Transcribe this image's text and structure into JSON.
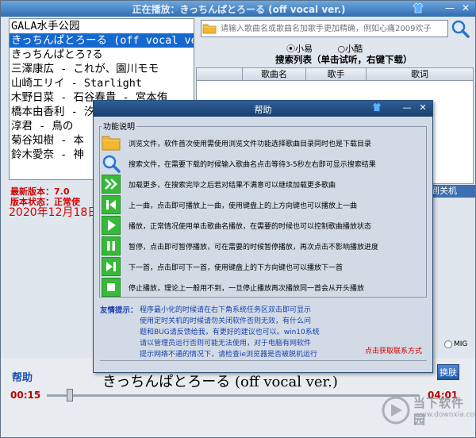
{
  "window": {
    "title": "正在播放：きっちんぱとろーる (off vocal ver.)"
  },
  "song_list": [
    {
      "text": "GALA水手公园",
      "selected": false
    },
    {
      "text": "きっちんぱとろーる (off vocal ver.)",
      "selected": true
    },
    {
      "text": "きっちんぱとろ?る",
      "selected": false
    },
    {
      "text": "三澤康広 - これが、園川モモ",
      "selected": false
    },
    {
      "text": "山崎エリイ - Starlight",
      "selected": false
    },
    {
      "text": "木野日菜 - 石谷春貴 - 宮本侑",
      "selected": false
    },
    {
      "text": "橋本由香利 - 汐",
      "selected": false
    },
    {
      "text": "淳君 - 鳥の",
      "selected": false
    },
    {
      "text": "菊谷知樹 - 本",
      "selected": false
    },
    {
      "text": "鈴木愛奈 - 神",
      "selected": false
    }
  ],
  "search": {
    "placeholder": "请输入歌曲名或歌曲名加歌手更加精确，例如心痛2009欢子",
    "source_options": [
      "小易",
      "小酷"
    ],
    "source_selected": "小易",
    "results_title": "搜索列表（单击试听，右键下载）",
    "columns": [
      "歌曲名",
      "歌手",
      "歌词"
    ]
  },
  "status": {
    "version": "最新版本：7.0",
    "state": "版本状态：正常使",
    "date": "2020年12月18日",
    "shutdown": "到关机"
  },
  "mig_label": "MIG",
  "bottom": {
    "help_link": "帮助",
    "now_playing": "きっちんぱとろーる (off vocal ver.)",
    "switch_button": "换肤",
    "elapsed": "00:15",
    "total": "04:01",
    "progress_fraction": 0.062
  },
  "watermark": {
    "text": "当下软件园",
    "sub": "www.downxia.com"
  },
  "help": {
    "title": "帮助",
    "legend": "功能说明",
    "items": [
      {
        "icon": "folder-icon",
        "text": "浏览文件，软件首次使用需使用浏览文件功能选择歌曲目录同时也是下载目录"
      },
      {
        "icon": "search-icon",
        "text": "搜索文件，在需要下载的时候输入歌曲名点击等待3-5秒左右即可显示搜索结果"
      },
      {
        "icon": "double-chevron-icon",
        "text": "加载更多，在搜索完毕之后若对结果不满意可以继续加载更多歌曲"
      },
      {
        "icon": "previous-icon",
        "text": "上一曲，点击即可播放上一曲，使用键盘上的上方向键也可以播放上一曲"
      },
      {
        "icon": "play-icon",
        "text": "播放，正常情况使用单击歌曲名播放，在需要的时候也可以控制歌曲播放状态"
      },
      {
        "icon": "pause-icon",
        "text": "暂停，点击即可暂停播放，可在需要的时候暂停播放，再次点击不影响播放进度"
      },
      {
        "icon": "next-icon",
        "text": "下一首，点击即可下一首，使用键盘上的下方向键也可以播放下一首"
      },
      {
        "icon": "stop-icon",
        "text": "停止播放，理论上一般用不到，一旦停止播放再次播放同一首会从开头播放"
      }
    ],
    "tip_label": "友情提示：",
    "tips": [
      "程序最小化的时候请在右下角系统任务区双击即可显示",
      "使用定时关机的时候请勿关闭软件否则无效，有什么问",
      "题和BUG请反馈给我，有更好的建议也可以。win10系统",
      "请以管理员运行否则可能无法使用，对于电脑有网软件",
      "提示网络不通的情况下，请检查ie浏览器是否被脱机运行"
    ],
    "contact": "点击获取联系方式"
  },
  "colors": {
    "accent_blue": "#1668d0",
    "status_red": "#d40000",
    "icon_green": "#37b93a",
    "dialog_title": "#17406f"
  }
}
